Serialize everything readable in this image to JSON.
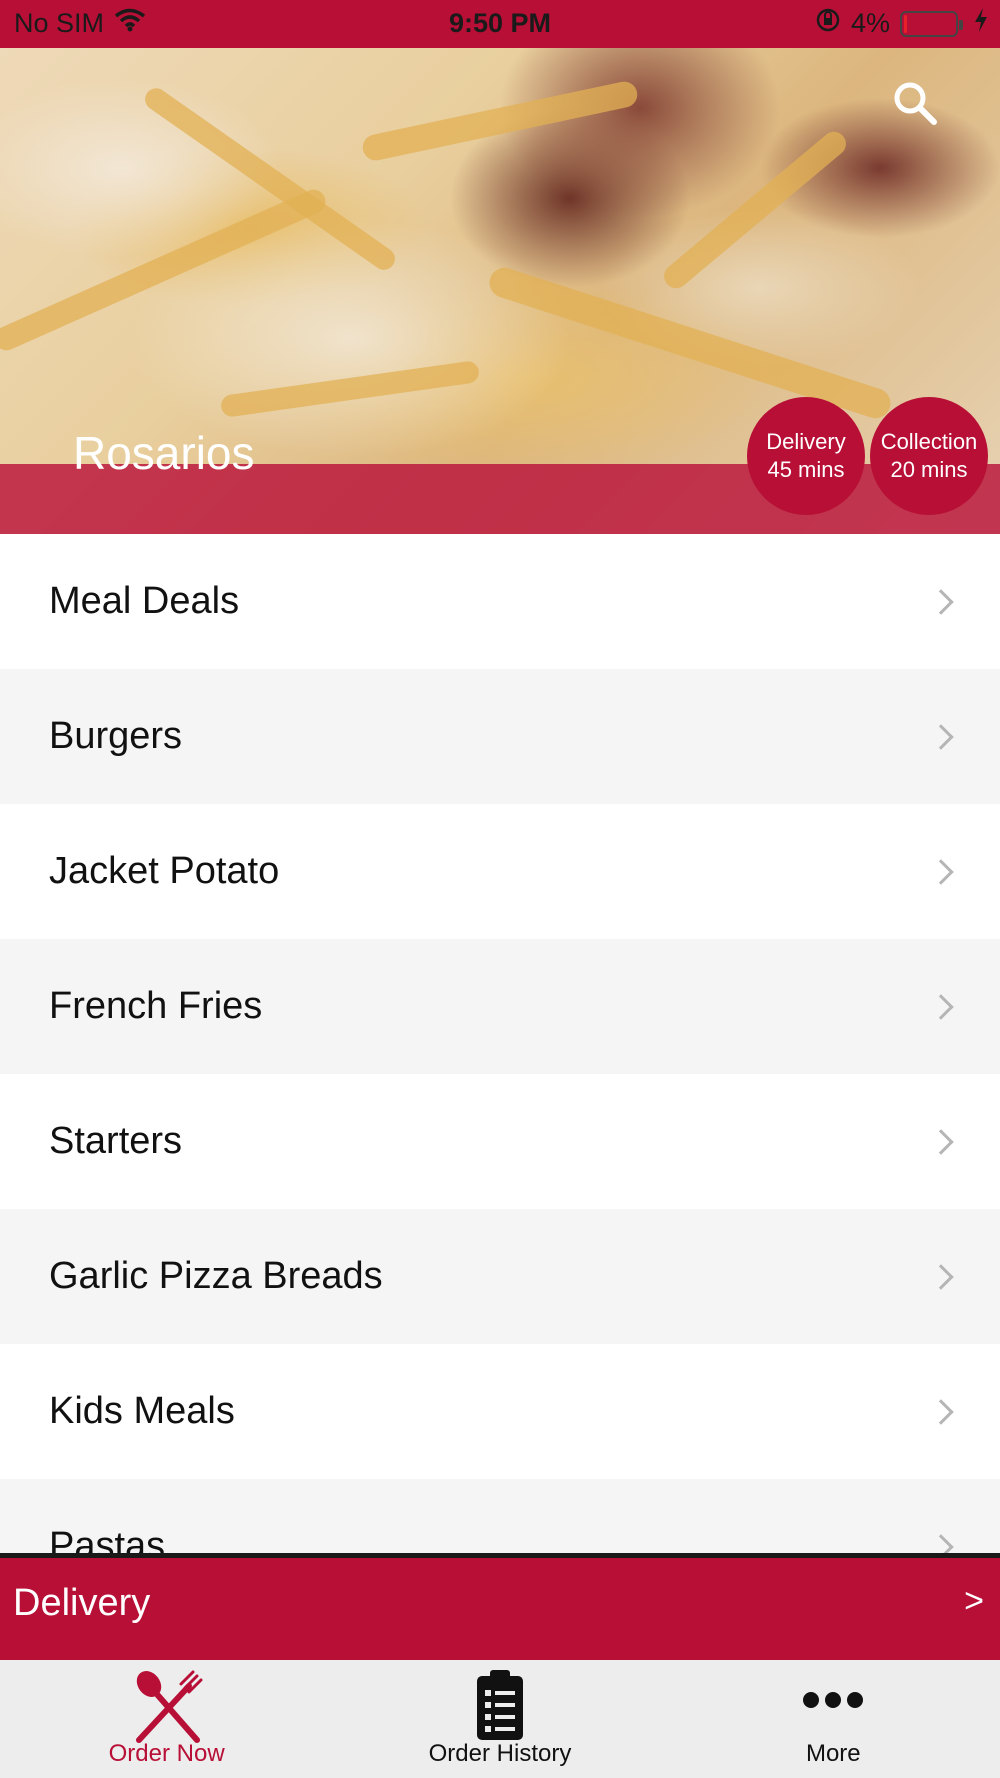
{
  "status_bar": {
    "carrier": "No SIM",
    "time": "9:50 PM",
    "battery": "4%",
    "battery_level": 0.04,
    "icons": [
      "wifi-icon",
      "orientation-lock-icon",
      "battery-icon",
      "charging-bolt-icon"
    ]
  },
  "header": {
    "store_name": "Rosarios",
    "search_icon": "search-icon",
    "delivery_badge": {
      "title": "Delivery",
      "time": "45 mins"
    },
    "collection_badge": {
      "title": "Collection",
      "time": "20 mins"
    }
  },
  "menu": {
    "categories": [
      {
        "label": "Meal Deals"
      },
      {
        "label": "Burgers"
      },
      {
        "label": "Jacket Potato"
      },
      {
        "label": "French Fries"
      },
      {
        "label": "Starters"
      },
      {
        "label": "Garlic Pizza Breads"
      },
      {
        "label": "Kids Meals"
      },
      {
        "label": "Pastas"
      }
    ]
  },
  "delivery_bar": {
    "label": "Delivery",
    "arrow": ">"
  },
  "tabs": [
    {
      "label": "Order Now",
      "icon": "fork-knife-icon",
      "active": true
    },
    {
      "label": "Order History",
      "icon": "clipboard-list-icon",
      "active": false
    },
    {
      "label": "More",
      "icon": "more-dots-icon",
      "active": false
    }
  ],
  "colors": {
    "brand": "#b80f36",
    "tab_bar_bg": "#ededed",
    "alt_row_bg": "#f5f5f5"
  }
}
